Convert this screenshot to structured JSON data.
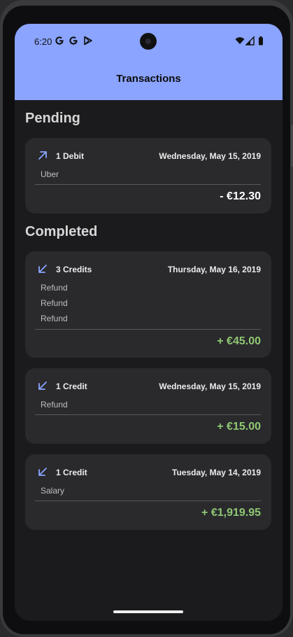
{
  "status_bar": {
    "time": "6:20",
    "left_icons": [
      "google-g-icon",
      "google-g-icon",
      "play-store-icon"
    ],
    "right_icons": [
      "wifi-icon",
      "signal-icon",
      "battery-icon"
    ]
  },
  "appbar": {
    "title": "Transactions",
    "color": "#8aa4ff"
  },
  "sections": {
    "pending": "Pending",
    "completed": "Completed"
  },
  "pending_cards": [
    {
      "direction": "debit",
      "kind": "1 Debit",
      "date": "Wednesday, May 15, 2019",
      "lines": [
        "Uber"
      ],
      "amount": "- €12.30"
    }
  ],
  "completed_cards": [
    {
      "direction": "credit",
      "kind": "3 Credits",
      "date": "Thursday, May 16, 2019",
      "lines": [
        "Refund",
        "Refund",
        "Refund"
      ],
      "amount": "+ €45.00"
    },
    {
      "direction": "credit",
      "kind": "1 Credit",
      "date": "Wednesday, May 15, 2019",
      "lines": [
        "Refund"
      ],
      "amount": "+ €15.00"
    },
    {
      "direction": "credit",
      "kind": "1 Credit",
      "date": "Tuesday, May 14, 2019",
      "lines": [
        "Salary"
      ],
      "amount": "+ €1,919.95"
    }
  ],
  "colors": {
    "credit_amount": "#8fc873",
    "debit_amount": "#ffffff",
    "arrow": "#8aa4ff"
  }
}
